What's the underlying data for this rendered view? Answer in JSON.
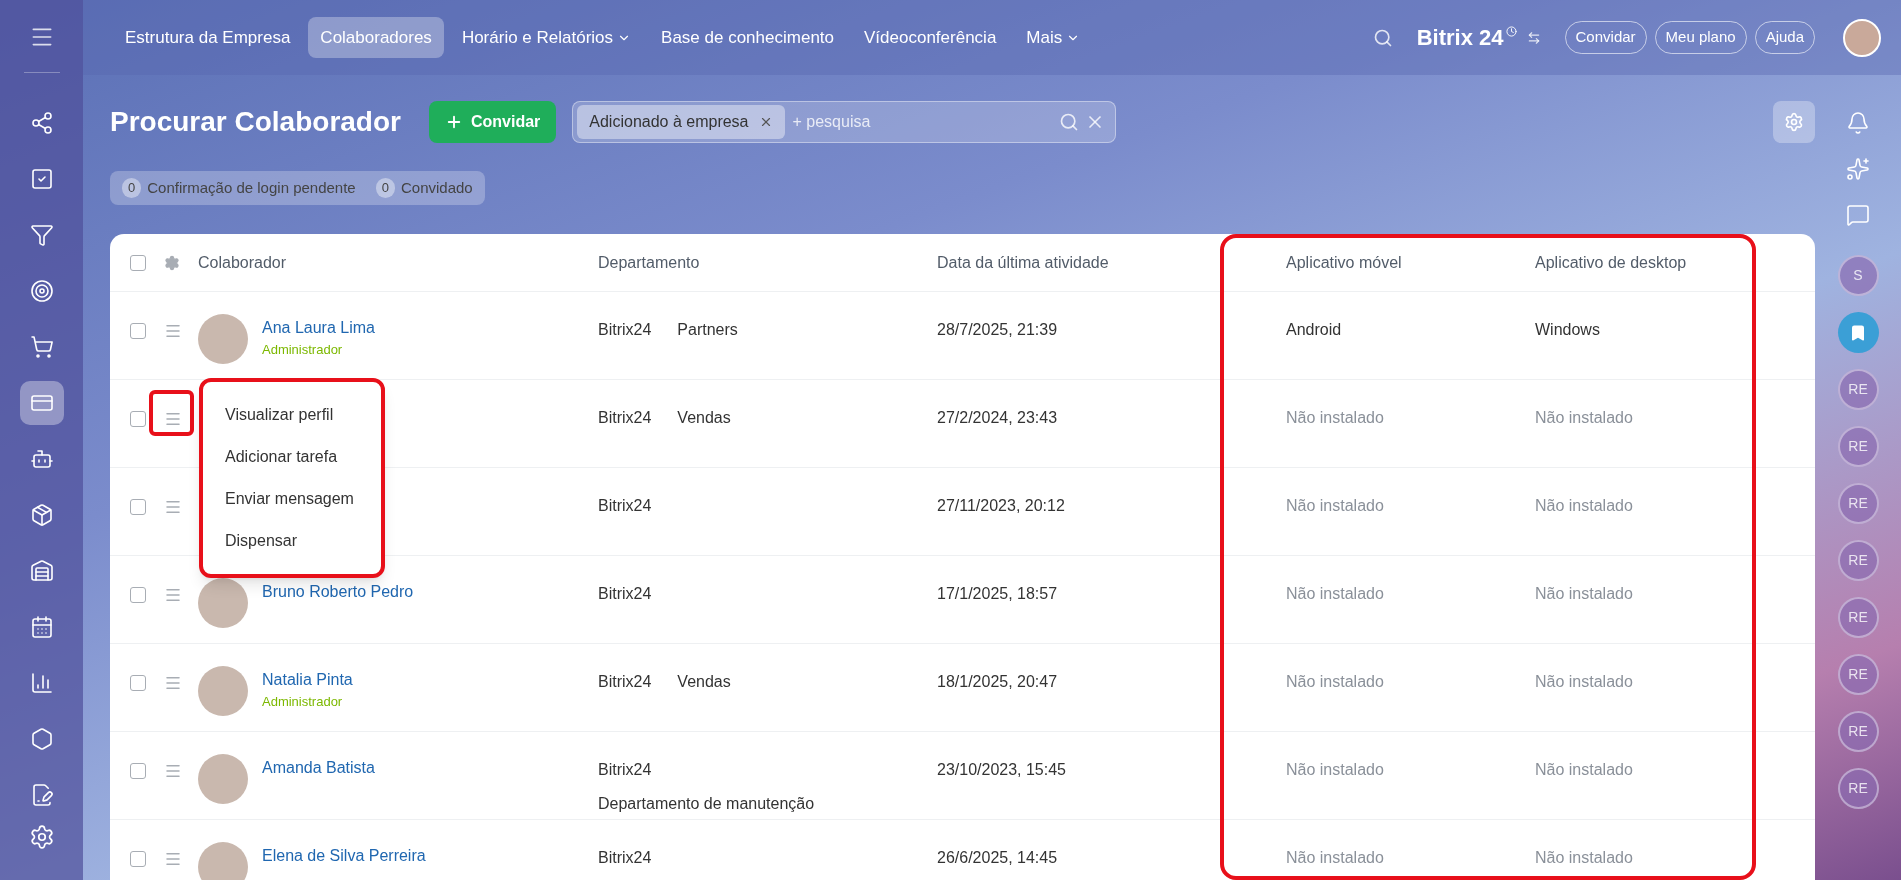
{
  "left_sidebar": {
    "items": [
      {
        "selected": false
      },
      {
        "selected": false
      },
      {
        "selected": false
      },
      {
        "selected": false
      },
      {
        "selected": false
      },
      {
        "selected": true
      },
      {
        "selected": false
      },
      {
        "selected": false
      },
      {
        "selected": false
      },
      {
        "selected": false
      },
      {
        "selected": false
      },
      {
        "selected": false
      },
      {
        "selected": false
      }
    ]
  },
  "top_nav": {
    "items": [
      {
        "label": "Estrutura da Empresa",
        "selected": false,
        "dropdown": false
      },
      {
        "label": "Colaboradores",
        "selected": true,
        "dropdown": false
      },
      {
        "label": "Horário e Relatórios",
        "selected": false,
        "dropdown": true
      },
      {
        "label": "Base de conhecimento",
        "selected": false,
        "dropdown": false
      },
      {
        "label": "Vídeoconferência",
        "selected": false,
        "dropdown": false
      },
      {
        "label": "Mais",
        "selected": false,
        "dropdown": true
      }
    ]
  },
  "header": {
    "logo": "Bitrix 24",
    "buttons": [
      "Convidar",
      "Meu plano",
      "Ajuda"
    ]
  },
  "page": {
    "title": "Procurar Colaborador",
    "invite_button": "Convidar",
    "filter": {
      "tag": "Adicionado à empresa",
      "placeholder": "+ pesquisa"
    },
    "counters": [
      {
        "count": "0",
        "label": "Confirmação de login pendente"
      },
      {
        "count": "0",
        "label": "Convidado"
      }
    ]
  },
  "table": {
    "select_all_checked": false,
    "columns": [
      "Colaborador",
      "Departamento",
      "Data da última atividade",
      "Aplicativo móvel",
      "Aplicativo de desktop"
    ],
    "rows": [
      {
        "checked": false,
        "avatar": true,
        "name": "Ana Laura Lima",
        "role": "Administrador",
        "department": [
          "Bitrix24",
          "Partners"
        ],
        "last_activity": "28/7/2025, 21:39",
        "mobile_app": "Android",
        "desktop_app": "Windows",
        "installed": true
      },
      {
        "checked": false,
        "avatar": false,
        "department": [
          "Bitrix24",
          "Vendas"
        ],
        "last_activity": "27/2/2024, 23:43",
        "mobile_app": "Não instalado",
        "desktop_app": "Não instalado",
        "installed": false
      },
      {
        "checked": false,
        "avatar": false,
        "department": [
          "Bitrix24"
        ],
        "last_activity": "27/11/2023, 20:12",
        "mobile_app": "Não instalado",
        "desktop_app": "Não instalado",
        "installed": false
      },
      {
        "checked": false,
        "avatar": true,
        "name": "Bruno Roberto Pedro",
        "department": [
          "Bitrix24"
        ],
        "last_activity": "17/1/2025, 18:57",
        "mobile_app": "Não instalado",
        "desktop_app": "Não instalado",
        "installed": false
      },
      {
        "checked": false,
        "avatar": true,
        "name": "Natalia Pinta",
        "role": "Administrador",
        "department": [
          "Bitrix24",
          "Vendas"
        ],
        "last_activity": "18/1/2025, 20:47",
        "mobile_app": "Não instalado",
        "desktop_app": "Não instalado",
        "installed": false
      },
      {
        "checked": false,
        "avatar": true,
        "name": "Amanda Batista",
        "department": [
          "Bitrix24"
        ],
        "department_note": "Departamento de manutenção",
        "last_activity": "23/10/2023, 15:45",
        "mobile_app": "Não instalado",
        "desktop_app": "Não instalado",
        "installed": false
      },
      {
        "checked": false,
        "avatar": true,
        "name": "Elena de Silva Perreira",
        "department": [
          "Bitrix24"
        ],
        "last_activity": "26/6/2025, 14:45",
        "mobile_app": "Não instalado",
        "desktop_app": "Não instalado",
        "installed": false
      }
    ]
  },
  "context_menu": {
    "items": [
      "Visualizar perfil",
      "Adicionar tarefa",
      "Enviar mensagem",
      "Dispensar"
    ]
  },
  "right_sidebar": {
    "items": [
      {
        "kind": "initials",
        "initials": "S"
      },
      {
        "kind": "bookmark"
      },
      {
        "kind": "initials",
        "initials": "RE"
      },
      {
        "kind": "initials",
        "initials": "RE"
      },
      {
        "kind": "initials",
        "initials": "RE"
      },
      {
        "kind": "initials",
        "initials": "RE"
      },
      {
        "kind": "initials",
        "initials": "RE"
      },
      {
        "kind": "initials",
        "initials": "RE"
      },
      {
        "kind": "initials",
        "initials": "RE"
      },
      {
        "kind": "initials",
        "initials": "RE"
      }
    ]
  }
}
